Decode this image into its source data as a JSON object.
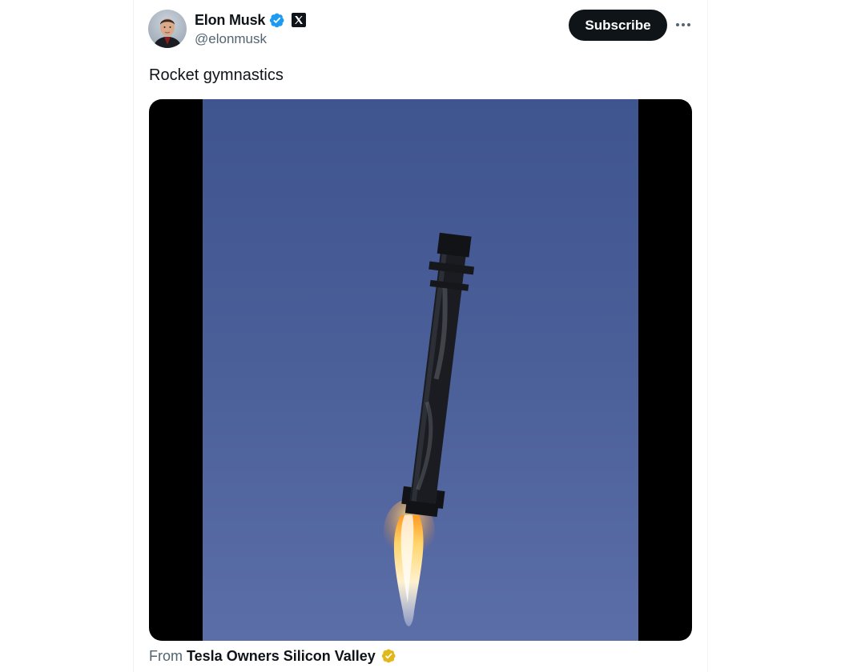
{
  "post": {
    "author": {
      "display_name": "Elon Musk",
      "handle": "@elonmusk",
      "verified_badge_icon": "verified-badge-icon",
      "affiliate_icon": "x-logo-icon"
    },
    "actions": {
      "subscribe_label": "Subscribe",
      "more_icon": "more-options-icon"
    },
    "text": "Rocket gymnastics",
    "media": {
      "type": "video"
    },
    "attribution": {
      "prefix": "From",
      "source_name": "Tesla Owners Silicon Valley",
      "badge_icon": "gold-verified-badge-icon"
    }
  },
  "colors": {
    "primary_text": "#0f1419",
    "secondary_text": "#536471",
    "verified_blue": "#1d9bf0",
    "gold_badge": "#e2b719",
    "sky": "#4a5f98"
  }
}
